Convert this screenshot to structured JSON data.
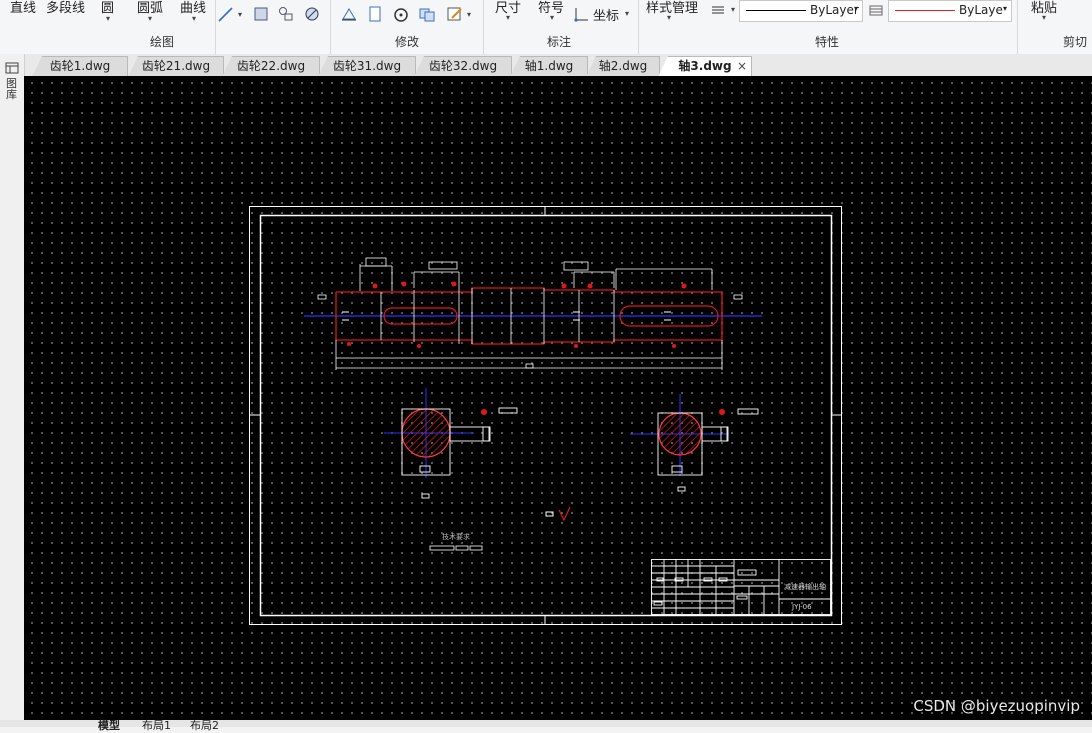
{
  "ribbon": {
    "draw": {
      "line": "直线",
      "polyline": "多段线",
      "circle": "圆",
      "arc": "圆弧",
      "curve": "曲线",
      "title": "绘图"
    },
    "modify": {
      "title": "修改"
    },
    "annotate": {
      "dimension": "尺寸",
      "symbol": "符号",
      "coordinate": "坐标",
      "title": "标注"
    },
    "properties": {
      "style_manager": "样式管理",
      "linetype_value": "ByLayer",
      "color_value": "ByLaye",
      "title": "特性"
    },
    "clipboard": {
      "paste": "粘贴",
      "title": "剪切"
    },
    "colors": {
      "linetype": "#000000",
      "color": "#e02020"
    }
  },
  "tabs": [
    {
      "label": "齿轮1.dwg",
      "active": false
    },
    {
      "label": "齿轮21.dwg",
      "active": false
    },
    {
      "label": "齿轮22.dwg",
      "active": false
    },
    {
      "label": "齿轮31.dwg",
      "active": false
    },
    {
      "label": "齿轮32.dwg",
      "active": false
    },
    {
      "label": "轴1.dwg",
      "active": false
    },
    {
      "label": "轴2.dwg",
      "active": false
    },
    {
      "label": "轴3.dwg",
      "active": true
    }
  ],
  "tab_close": "×",
  "left_panel": {
    "label": "图库"
  },
  "drawing": {
    "tech_requirements": "技术要求",
    "title_block_name": "减速器输出轴",
    "title_block_code": "JYJ-06",
    "colors": {
      "frame": "#ffffff",
      "part": "#e01818",
      "center": "#2a34ff",
      "hatch": "#d01a1a"
    }
  },
  "layout_tabs": [
    "模型",
    "布局1",
    "布局2"
  ],
  "watermark": "CSDN @biyezuopinvip"
}
